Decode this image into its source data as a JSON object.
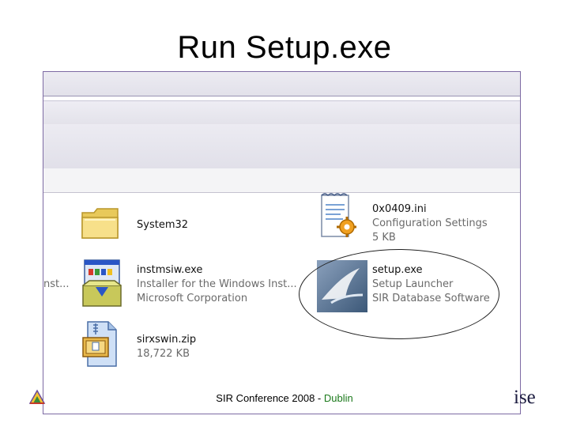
{
  "slide": {
    "title": "Run Setup.exe"
  },
  "files": {
    "system32": {
      "name": "System32"
    },
    "ini": {
      "name": "0x0409.ini",
      "type": "Configuration Settings",
      "size": "5 KB"
    },
    "instmsiw": {
      "name": "instmsiw.exe",
      "type": "Installer for the Windows Inst...",
      "company": "Microsoft Corporation"
    },
    "setup": {
      "name": "setup.exe",
      "type": "Setup Launcher",
      "company": "SIR Database Software"
    },
    "sirxswin": {
      "name": "sirxswin.zip",
      "size": "18,722 KB"
    }
  },
  "left_truncated": "nst...",
  "footer": {
    "text": "SIR Conference 2008 - ",
    "location": "Dublin"
  },
  "right_logo_text": "ise",
  "icons": [
    "folder-icon",
    "ini-settings-icon",
    "installer-icon",
    "setup-launcher-icon",
    "zip-archive-icon",
    "conference-logo-icon"
  ]
}
